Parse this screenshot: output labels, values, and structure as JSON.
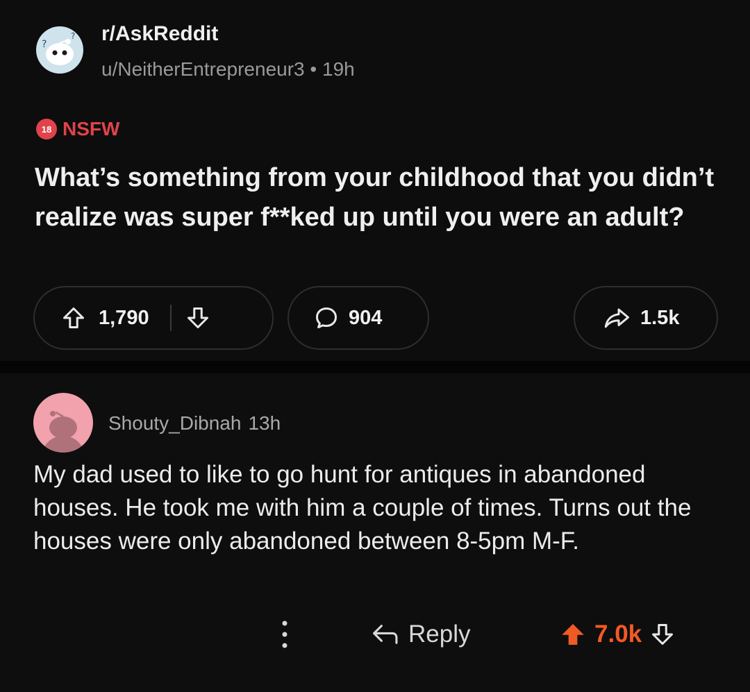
{
  "post": {
    "subreddit": "r/AskReddit",
    "username": "u/NeitherEntrepreneur3",
    "separator": "•",
    "age": "19h",
    "nsfw_badge": "18",
    "nsfw_label": "NSFW",
    "title": "What’s something from your childhood that you didn’t realize was super f**ked up until you were an adult?",
    "upvotes": "1,790",
    "comments": "904",
    "shares": "1.5k"
  },
  "comment": {
    "author": "Shouty_Dibnah",
    "age": "13h",
    "body": "My dad used to like to go hunt for antiques in abandoned houses.  He took me with him a couple of times.  Turns out the houses were only abandoned between 8-5pm M-F.",
    "reply_label": "Reply",
    "score": "7.0k"
  },
  "colors": {
    "background": "#0b0b0b",
    "nsfw_red": "#e0434b",
    "upvote_orange": "#f15a24",
    "sub_avatar": "#cfe3ec",
    "user_avatar": "#f1a2ad"
  },
  "icons": [
    "subreddit-avatar-icon",
    "upvote-icon",
    "downvote-icon",
    "comment-bubble-icon",
    "share-arrow-icon",
    "more-dots-icon",
    "reply-arrow-icon",
    "upvote-filled-icon"
  ]
}
